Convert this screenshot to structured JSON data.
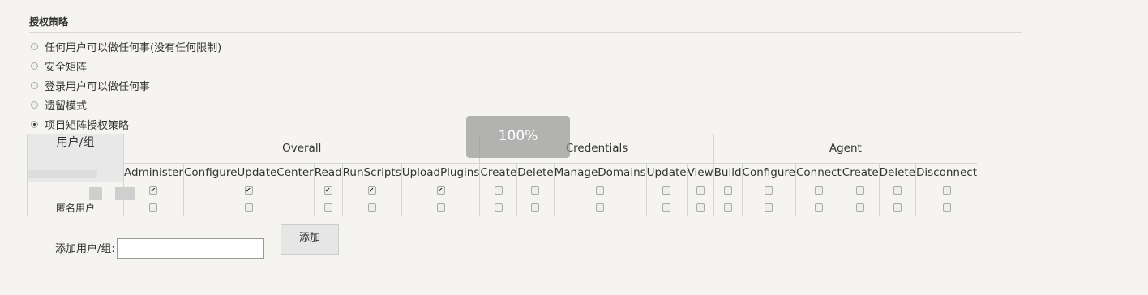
{
  "section": {
    "title": "授权策略"
  },
  "strategies": [
    {
      "label": "任何用户可以做任何事(没有任何限制)",
      "selected": false
    },
    {
      "label": "安全矩阵",
      "selected": false
    },
    {
      "label": "登录用户可以做任何事",
      "selected": false
    },
    {
      "label": "遗留模式",
      "selected": false
    },
    {
      "label": "项目矩阵授权策略",
      "selected": true
    }
  ],
  "matrix": {
    "user_header": "用户/组",
    "groups": [
      {
        "name": "Overall",
        "permissions": [
          "Administer",
          "ConfigureUpdateCenter",
          "Read",
          "RunScripts",
          "UploadPlugins"
        ]
      },
      {
        "name": "Credentials",
        "permissions": [
          "Create",
          "Delete",
          "ManageDomains",
          "Update",
          "View"
        ]
      },
      {
        "name": "Agent",
        "permissions": [
          "Build",
          "Configure",
          "Connect",
          "Create",
          "Delete",
          "Disconnect"
        ]
      }
    ],
    "rows": [
      {
        "label": "",
        "checks": [
          true,
          true,
          true,
          true,
          true,
          false,
          false,
          false,
          false,
          false,
          false,
          false,
          false,
          false,
          false,
          false
        ]
      },
      {
        "label": "匿名用户",
        "checks": [
          false,
          false,
          false,
          false,
          false,
          false,
          false,
          false,
          false,
          false,
          false,
          false,
          false,
          false,
          false,
          false
        ]
      }
    ]
  },
  "zoom_indicator": "100%",
  "add_user": {
    "label": "添加用户/组:",
    "value": "",
    "button_label": "添加"
  }
}
